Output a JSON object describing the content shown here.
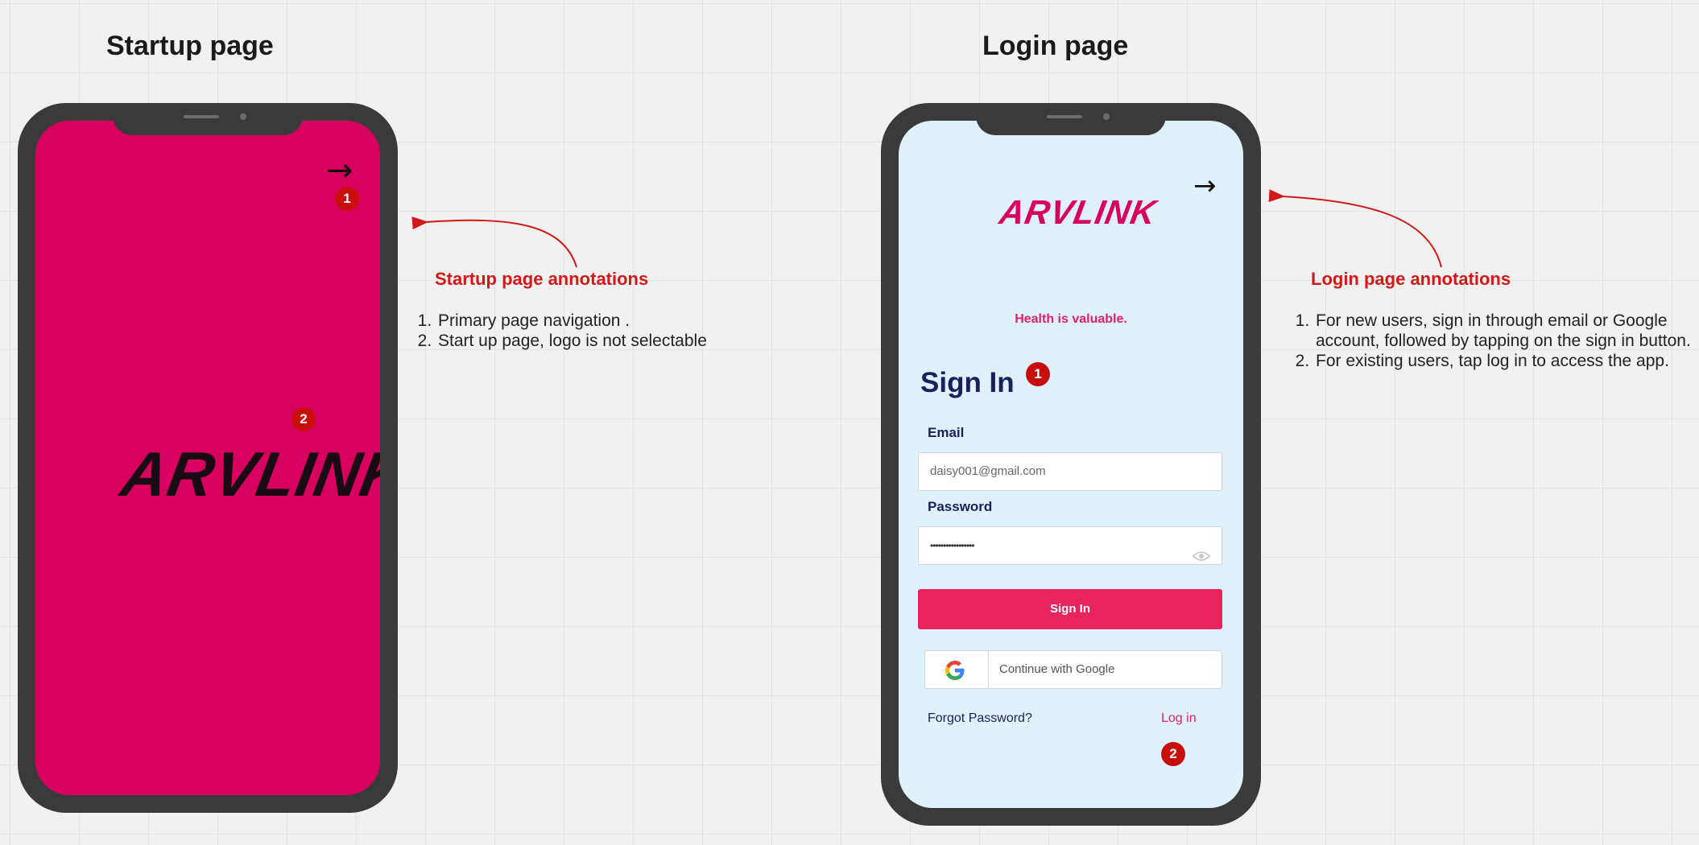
{
  "startup": {
    "title": "Startup page",
    "logo": "ARVLINK",
    "nav_arrow": "→",
    "badges": [
      "1",
      "2"
    ],
    "annotation_title": "Startup page annotations",
    "annotations": [
      "Primary page navigation .",
      "Start up page, logo is not selectable"
    ]
  },
  "login": {
    "title": "Login page",
    "logo": "ARVLINK",
    "nav_arrow": "→",
    "tagline": "Health is valuable.",
    "signin_title": "Sign In",
    "badges": [
      "1",
      "2"
    ],
    "email_label": "Email",
    "email_value": "daisy001@gmail.com",
    "password_label": "Password",
    "password_value": "•••••••••••••••••",
    "signin_button": "Sign In",
    "google_button": "Continue with Google",
    "forgot_password": "Forgot Password?",
    "log_in": "Log in",
    "annotation_title": "Login page annotations",
    "annotations": [
      "For new users, sign in through email or Google account, followed by tapping on the sign in button.",
      "For existing users, tap log in to access the app."
    ]
  },
  "colors": {
    "startup_background": "#d8005f",
    "login_background": "#dff2fb",
    "accent_pink": "#e8245e",
    "annotation_red": "#d11919",
    "badge_red": "#c80d0d",
    "phone_frame": "#3a3a3a"
  },
  "icons": [
    "arrow-right-icon",
    "eye-icon",
    "google-icon"
  ]
}
